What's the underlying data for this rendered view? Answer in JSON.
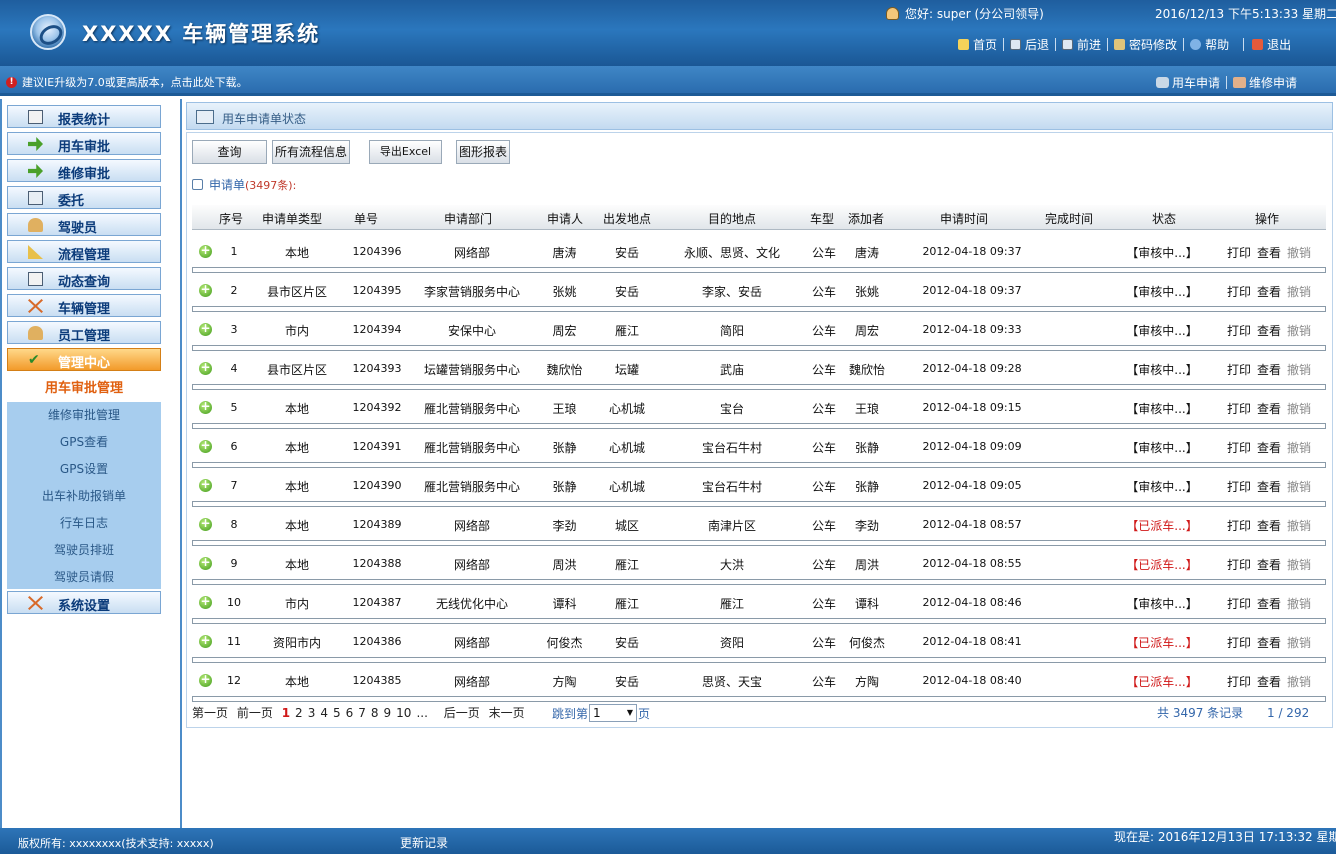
{
  "header": {
    "system_title": "XXXXX 车辆管理系统",
    "greeting": "您好: super (分公司领导)",
    "datetime": "2016/12/13 下午5:13:33 星期二",
    "nav": [
      "首页",
      "后退",
      "前进",
      "密码修改",
      "帮助",
      "退出"
    ]
  },
  "notice": "建议IE升级为7.0或更高版本，点击此处下载。",
  "quicklinks": [
    "用车申请",
    "维修申请"
  ],
  "sidebar": {
    "menus": [
      {
        "label": "报表统计",
        "icon": "report-icon"
      },
      {
        "label": "用车审批",
        "icon": "arrow-icon"
      },
      {
        "label": "维修审批",
        "icon": "arrow-icon"
      },
      {
        "label": "委托",
        "icon": "delegate-icon"
      },
      {
        "label": "驾驶员",
        "icon": "driver-icon"
      },
      {
        "label": "流程管理",
        "icon": "ruler-icon"
      },
      {
        "label": "动态查询",
        "icon": "query-icon"
      },
      {
        "label": "车辆管理",
        "icon": "tools-icon"
      },
      {
        "label": "员工管理",
        "icon": "person-icon"
      },
      {
        "label": "管理中心",
        "icon": "check-icon"
      }
    ],
    "submenu": [
      "用车审批管理",
      "维修审批管理",
      "GPS查看",
      "GPS设置",
      "出车补助报销单",
      "行车日志",
      "驾驶员排班",
      "驾驶员请假"
    ],
    "last_menu": {
      "label": "系统设置",
      "icon": "tools-icon"
    }
  },
  "panel": {
    "title": "用车申请单状态",
    "buttons": [
      "查询",
      "所有流程信息",
      "导出Excel",
      "图形报表"
    ],
    "count_label": "申请单",
    "count": "(3497条):"
  },
  "table": {
    "headers": [
      "序号",
      "申请单类型",
      "单号",
      "申请部门",
      "申请人",
      "出发地点",
      "目的地点",
      "车型",
      "添加者",
      "申请时间",
      "完成时间",
      "状态",
      "操作"
    ],
    "actions": [
      "打印",
      "查看",
      "撤销"
    ],
    "rows": [
      {
        "no": "1",
        "type": "本地",
        "id": "1204396",
        "dept": "网络部",
        "applicant": "唐涛",
        "from": "安岳",
        "to": "永顺、思贤、文化",
        "car": "公车",
        "adder": "唐涛",
        "time": "2012-04-18 09:37",
        "done": "",
        "status": "【审核中...】",
        "dispatched": false
      },
      {
        "no": "2",
        "type": "县市区片区",
        "id": "1204395",
        "dept": "李家营销服务中心",
        "applicant": "张姚",
        "from": "安岳",
        "to": "李家、安岳",
        "car": "公车",
        "adder": "张姚",
        "time": "2012-04-18 09:37",
        "done": "",
        "status": "【审核中...】",
        "dispatched": false
      },
      {
        "no": "3",
        "type": "市内",
        "id": "1204394",
        "dept": "安保中心",
        "applicant": "周宏",
        "from": "雁江",
        "to": "简阳",
        "car": "公车",
        "adder": "周宏",
        "time": "2012-04-18 09:33",
        "done": "",
        "status": "【审核中...】",
        "dispatched": false
      },
      {
        "no": "4",
        "type": "县市区片区",
        "id": "1204393",
        "dept": "坛罐营销服务中心",
        "applicant": "魏欣怡",
        "from": "坛罐",
        "to": "武庙",
        "car": "公车",
        "adder": "魏欣怡",
        "time": "2012-04-18 09:28",
        "done": "",
        "status": "【审核中...】",
        "dispatched": false
      },
      {
        "no": "5",
        "type": "本地",
        "id": "1204392",
        "dept": "雁北营销服务中心",
        "applicant": "王琅",
        "from": "心机城",
        "to": "宝台",
        "car": "公车",
        "adder": "王琅",
        "time": "2012-04-18 09:15",
        "done": "",
        "status": "【审核中...】",
        "dispatched": false
      },
      {
        "no": "6",
        "type": "本地",
        "id": "1204391",
        "dept": "雁北营销服务中心",
        "applicant": "张静",
        "from": "心机城",
        "to": "宝台石牛村",
        "car": "公车",
        "adder": "张静",
        "time": "2012-04-18 09:09",
        "done": "",
        "status": "【审核中...】",
        "dispatched": false
      },
      {
        "no": "7",
        "type": "本地",
        "id": "1204390",
        "dept": "雁北营销服务中心",
        "applicant": "张静",
        "from": "心机城",
        "to": "宝台石牛村",
        "car": "公车",
        "adder": "张静",
        "time": "2012-04-18 09:05",
        "done": "",
        "status": "【审核中...】",
        "dispatched": false
      },
      {
        "no": "8",
        "type": "本地",
        "id": "1204389",
        "dept": "网络部",
        "applicant": "李劲",
        "from": "城区",
        "to": "南津片区",
        "car": "公车",
        "adder": "李劲",
        "time": "2012-04-18 08:57",
        "done": "",
        "status": "【已派车...】",
        "dispatched": true
      },
      {
        "no": "9",
        "type": "本地",
        "id": "1204388",
        "dept": "网络部",
        "applicant": "周洪",
        "from": "雁江",
        "to": "大洪",
        "car": "公车",
        "adder": "周洪",
        "time": "2012-04-18 08:55",
        "done": "",
        "status": "【已派车...】",
        "dispatched": true
      },
      {
        "no": "10",
        "type": "市内",
        "id": "1204387",
        "dept": "无线优化中心",
        "applicant": "谭科",
        "from": "雁江",
        "to": "雁江",
        "car": "公车",
        "adder": "谭科",
        "time": "2012-04-18 08:46",
        "done": "",
        "status": "【审核中...】",
        "dispatched": false
      },
      {
        "no": "11",
        "type": "资阳市内",
        "id": "1204386",
        "dept": "网络部",
        "applicant": "何俊杰",
        "from": "安岳",
        "to": "资阳",
        "car": "公车",
        "adder": "何俊杰",
        "time": "2012-04-18 08:41",
        "done": "",
        "status": "【已派车...】",
        "dispatched": true
      },
      {
        "no": "12",
        "type": "本地",
        "id": "1204385",
        "dept": "网络部",
        "applicant": "方陶",
        "from": "安岳",
        "to": "思贤、天宝",
        "car": "公车",
        "adder": "方陶",
        "time": "2012-04-18 08:40",
        "done": "",
        "status": "【已派车...】",
        "dispatched": true
      }
    ]
  },
  "pager": {
    "first": "第一页",
    "prev": "前一页",
    "pages": [
      "1",
      "2",
      "3",
      "4",
      "5",
      "6",
      "7",
      "8",
      "9",
      "10",
      "..."
    ],
    "current": "1",
    "next": "后一页",
    "last": "末一页",
    "jump_prefix": "跳到第",
    "jump_value": "1",
    "jump_suffix": "页",
    "total": "共 3497 条记录",
    "page_of": "1 / 292"
  },
  "footer": {
    "copyright": "版权所有: xxxxxxxx(技术支持: xxxxx)",
    "changelog": "更新记录",
    "now": "现在是: 2016年12月13日 17:13:32 星期"
  },
  "colors": {
    "header_blue": "#2b77bd",
    "active_orange": "#f29a2a",
    "status_green": "#1a9a1a",
    "status_red": "#d01818",
    "submenu_blue": "#a7cdee"
  }
}
